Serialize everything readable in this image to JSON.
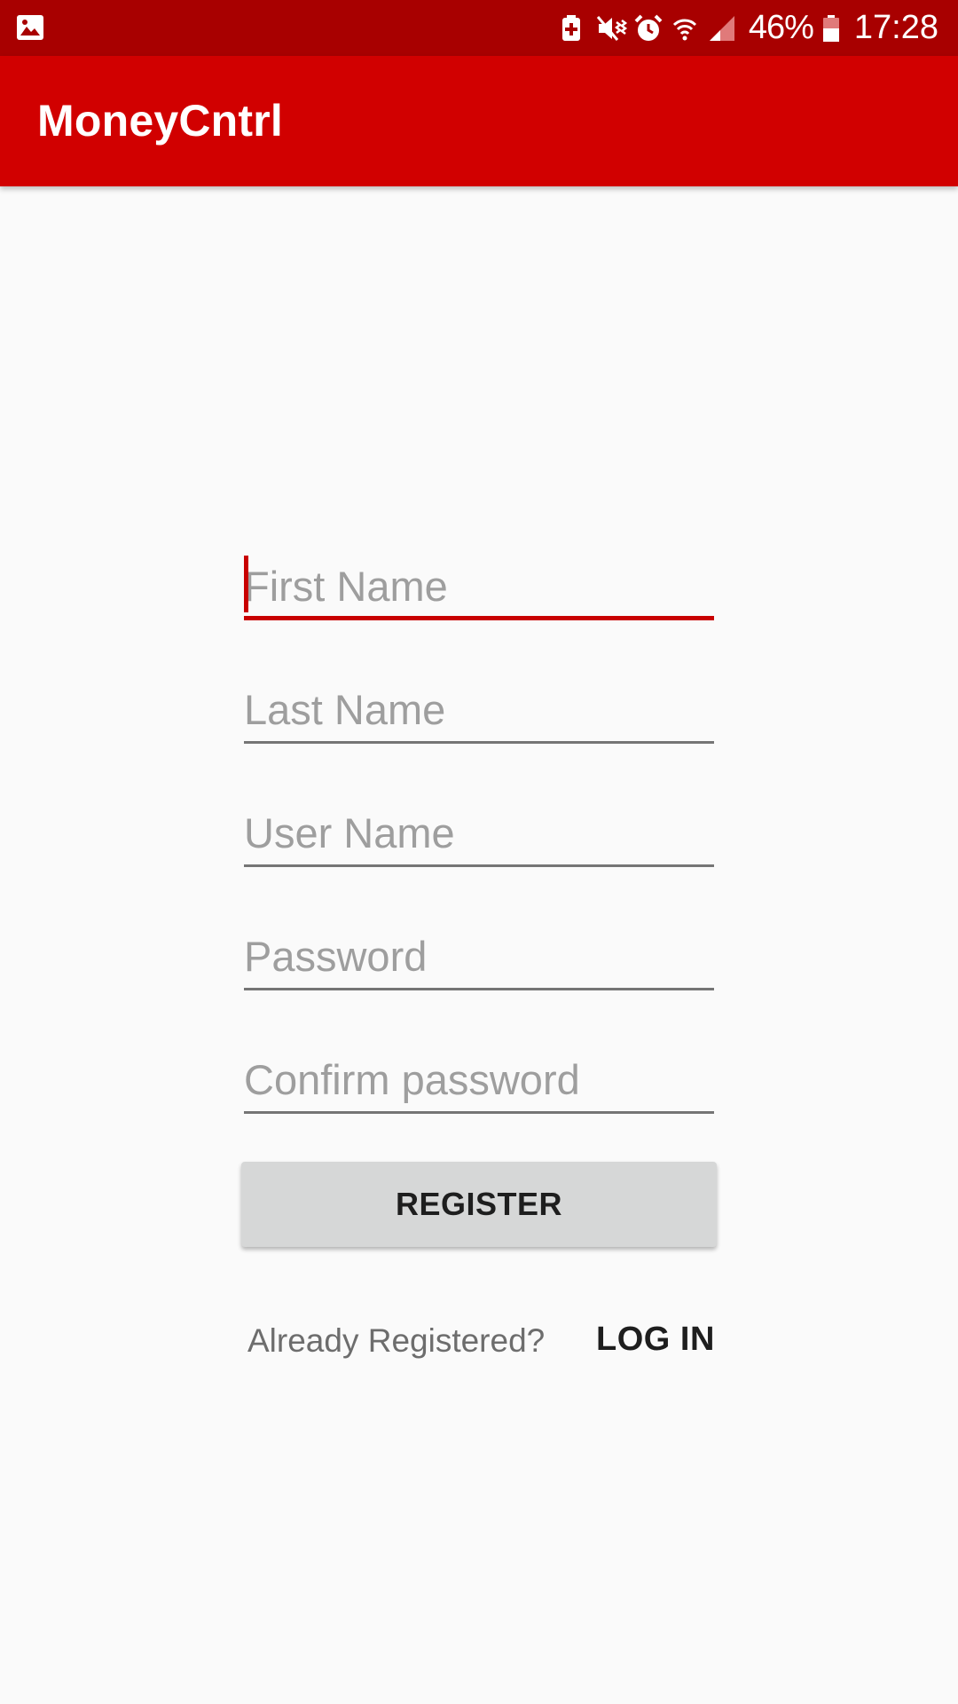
{
  "status_bar": {
    "battery_percent": "46%",
    "time": "17:28",
    "icons": [
      "gallery-icon",
      "battery-saver-icon",
      "mute-vibrate-icon",
      "alarm-icon",
      "wifi-icon",
      "signal-icon",
      "battery-icon"
    ]
  },
  "app_bar": {
    "title": "MoneyCntrl"
  },
  "form": {
    "first_name_placeholder": "First Name",
    "last_name_placeholder": "Last Name",
    "user_name_placeholder": "User Name",
    "password_placeholder": "Password",
    "confirm_password_placeholder": "Confirm password"
  },
  "register_label": "REGISTER",
  "already_registered_text": "Already Registered?",
  "login_label": "LOG IN",
  "colors": {
    "status_bar": "#a80000",
    "app_bar": "#d10000",
    "accent": "#c80000",
    "background": "#fafafa",
    "button": "#d6d7d7"
  }
}
